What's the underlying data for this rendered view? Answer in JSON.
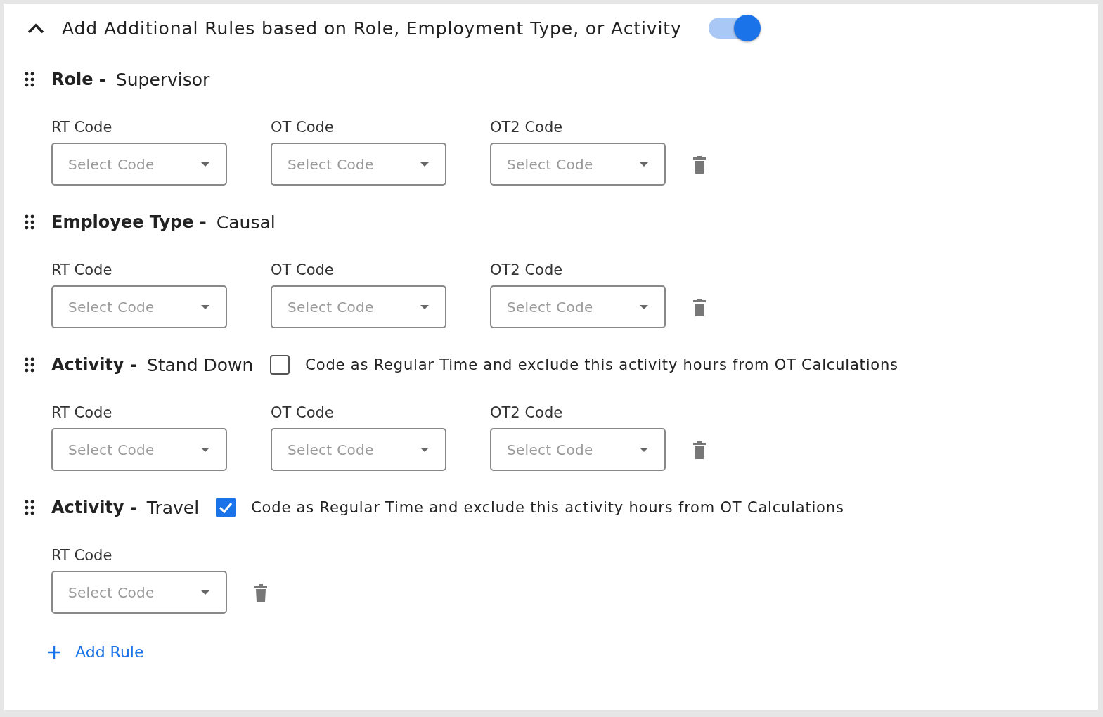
{
  "header": {
    "title": "Add Additional Rules based on Role, Employment Type, or Activity",
    "expanded": true,
    "toggle": {
      "on": true
    }
  },
  "rules": [
    {
      "heading": "Role -",
      "value": "Supervisor",
      "codes": [
        {
          "label": "RT Code",
          "placeholder": "Select Code"
        },
        {
          "label": "OT Code",
          "placeholder": "Select Code"
        },
        {
          "label": "OT2 Code",
          "placeholder": "Select Code"
        }
      ]
    },
    {
      "heading": "Employee Type -",
      "value": "Causal",
      "codes": [
        {
          "label": "RT Code",
          "placeholder": "Select Code"
        },
        {
          "label": "OT Code",
          "placeholder": "Select Code"
        },
        {
          "label": "OT2 Code",
          "placeholder": "Select Code"
        }
      ]
    },
    {
      "heading": "Activity -",
      "value": "Stand Down",
      "option": {
        "checked": false,
        "label": "Code as Regular Time and exclude this activity hours from OT Calculations"
      },
      "codes": [
        {
          "label": "RT Code",
          "placeholder": "Select Code"
        },
        {
          "label": "OT Code",
          "placeholder": "Select Code"
        },
        {
          "label": "OT2 Code",
          "placeholder": "Select Code"
        }
      ]
    },
    {
      "heading": "Activity -",
      "value": "Travel",
      "option": {
        "checked": true,
        "label": "Code as Regular Time and exclude this activity hours from OT Calculations"
      },
      "codes": [
        {
          "label": "RT Code",
          "placeholder": "Select Code"
        }
      ]
    }
  ],
  "add_rule": {
    "label": "Add Rule"
  }
}
